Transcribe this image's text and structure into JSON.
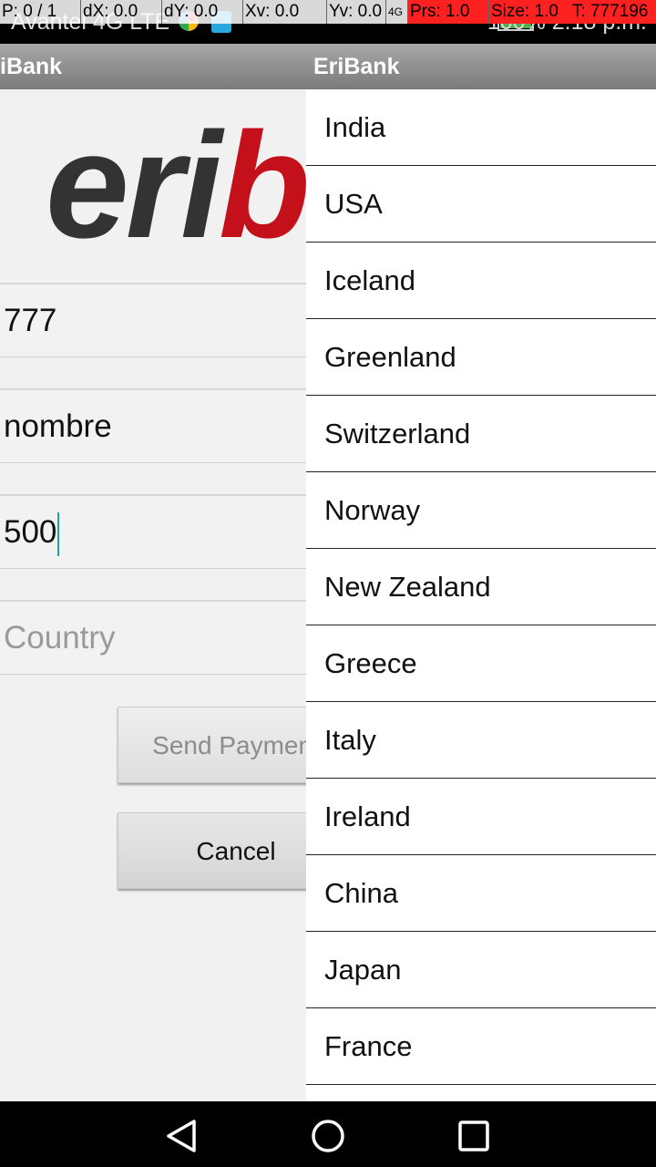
{
  "status_bar": {
    "carrier": "Avantel 4G LTE",
    "right_text": "100%    2:18 p.m."
  },
  "debug_overlay": [
    "P: 0 / 1",
    "dX: 0.0",
    "dY: 0.0",
    "Xv: 0.0",
    "Yv: 0.0",
    "4G",
    "Prs: 1.0",
    "Size: 1.0",
    "T: 777196"
  ],
  "left_app": {
    "title": "iBank",
    "logo_dark": "eri",
    "logo_red": "b",
    "fields": {
      "account": "777",
      "name": "nombre",
      "amount": "500",
      "country_placeholder": "Country"
    },
    "buttons": {
      "send": "Send Payment",
      "cancel": "Cancel"
    }
  },
  "right_app": {
    "title": "EriBank",
    "countries": [
      "India",
      "USA",
      "Iceland",
      "Greenland",
      "Switzerland",
      "Norway",
      "New Zealand",
      "Greece",
      "Italy",
      "Ireland",
      "China",
      "Japan",
      "France"
    ]
  },
  "nav": {
    "back": "back-icon",
    "home": "home-icon",
    "recents": "recents-icon"
  }
}
